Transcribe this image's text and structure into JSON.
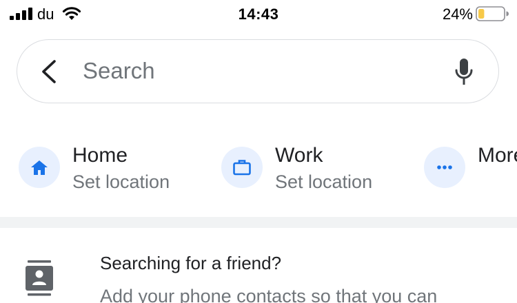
{
  "status_bar": {
    "carrier": "du",
    "time": "14:43",
    "battery_percent": "24%",
    "battery_level": 0.24,
    "battery_color": "#f7c948",
    "signal_icon": "cellular-signal-icon",
    "wifi_icon": "wifi-icon"
  },
  "search": {
    "placeholder": "Search",
    "value": "",
    "back_icon": "back-arrow-icon",
    "mic_icon": "microphone-icon"
  },
  "shortcuts": [
    {
      "title": "Home",
      "subtitle": "Set location",
      "icon": "home-icon"
    },
    {
      "title": "Work",
      "subtitle": "Set location",
      "icon": "briefcase-icon"
    },
    {
      "title": "More",
      "icon": "more-dots-icon"
    }
  ],
  "friend_card": {
    "title": "Searching for a friend?",
    "body": "Add your phone contacts so that you can",
    "icon": "contacts-icon"
  },
  "colors": {
    "accent_blue": "#1a73e8",
    "chip_background": "#e8f0fe",
    "divider": "#f1f3f4",
    "secondary_text": "#70757a",
    "icon_gray": "#5f6368"
  }
}
